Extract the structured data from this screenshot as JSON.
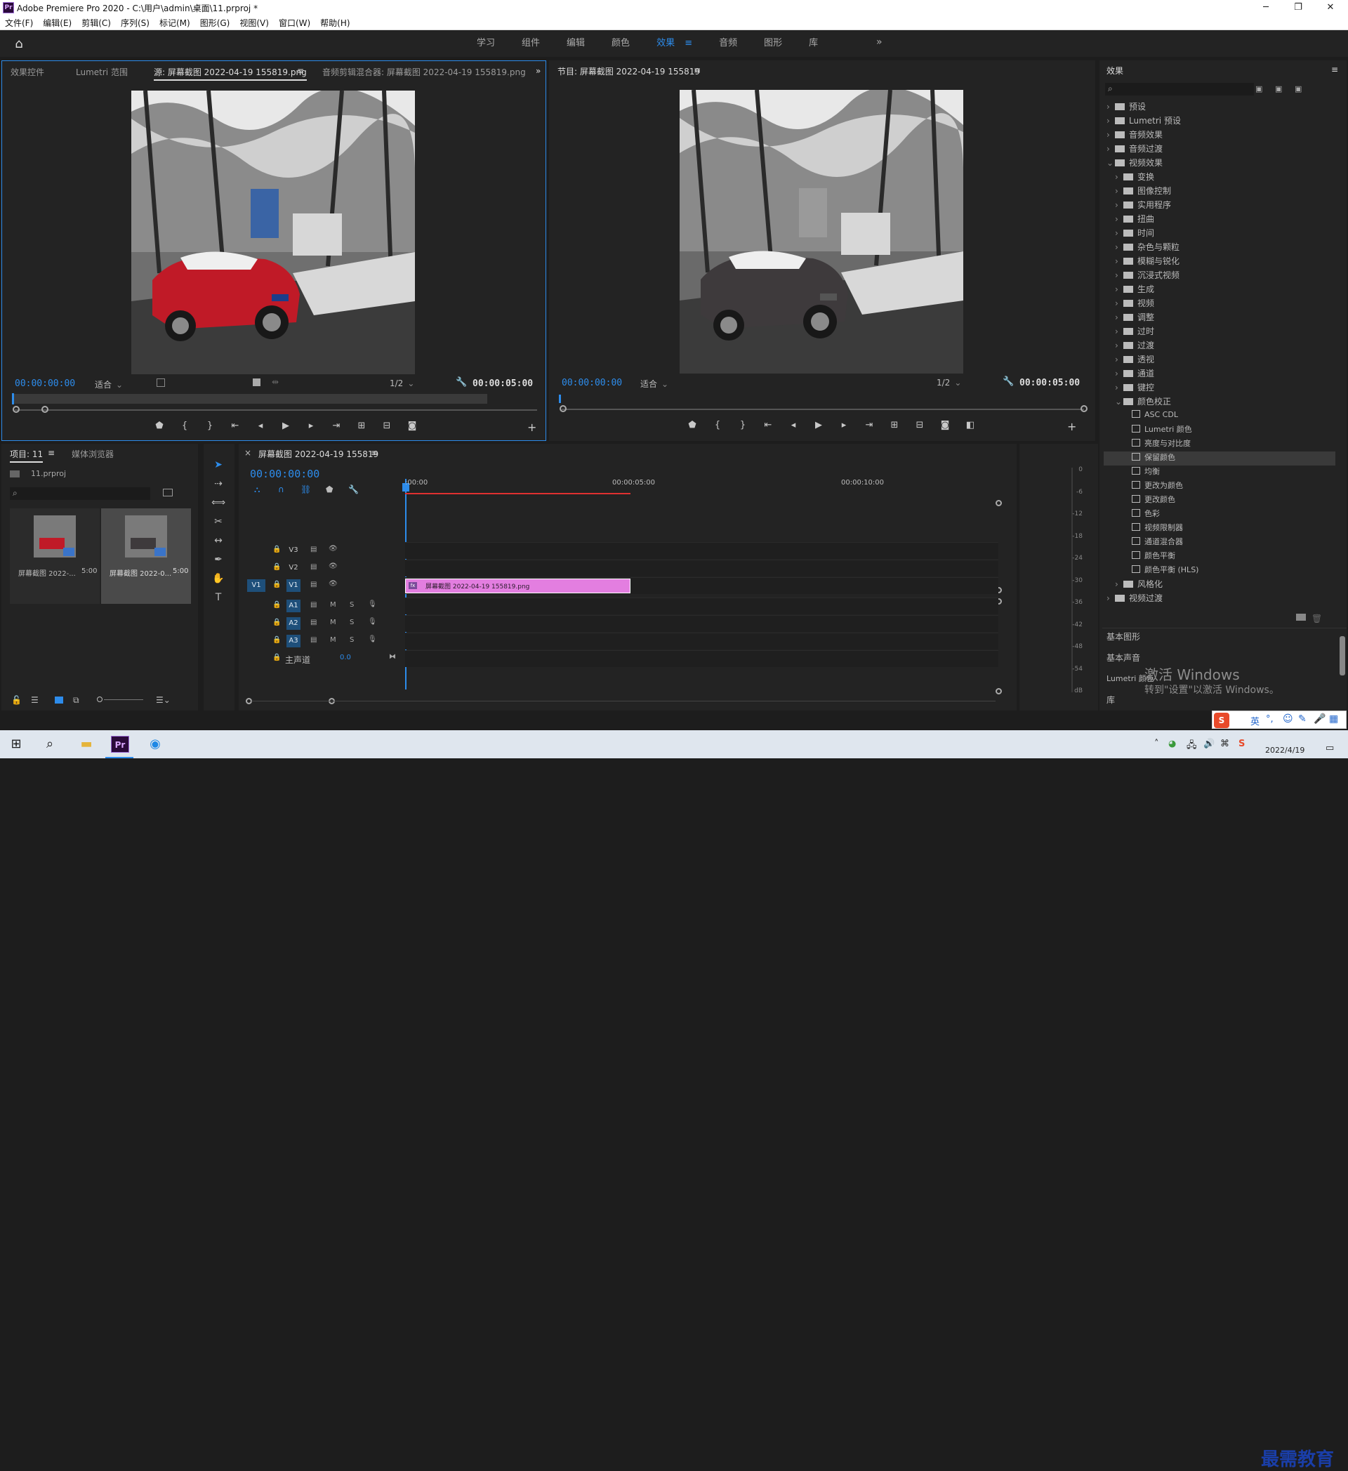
{
  "window": {
    "app_icon": "Pr",
    "title": "Adobe Premiere Pro 2020 - C:\\用户\\admin\\桌面\\11.prproj *",
    "min": "─",
    "max": "❐",
    "close": "✕"
  },
  "menu": [
    "文件(F)",
    "编辑(E)",
    "剪辑(C)",
    "序列(S)",
    "标记(M)",
    "图形(G)",
    "视图(V)",
    "窗口(W)",
    "帮助(H)"
  ],
  "workspaces": {
    "tabs": [
      "学习",
      "组件",
      "编辑",
      "颜色",
      "效果",
      "音频",
      "图形",
      "库"
    ],
    "active": "效果",
    "more": "»"
  },
  "source_panel": {
    "tabs": [
      "效果控件",
      "Lumetri 范围",
      "源: 屏幕截图 2022-04-19 155819.png",
      "音频剪辑混合器: 屏幕截图 2022-04-19 155819.png"
    ],
    "active_tab": "源: 屏幕截图 2022-04-19 155819.png",
    "timecode": "00:00:00:00",
    "fit": "适合",
    "resolution": "1/2",
    "duration": "00:00:05:00"
  },
  "program_panel": {
    "tab": "节目: 屏幕截图 2022-04-19 155819",
    "timecode": "00:00:00:00",
    "fit": "适合",
    "resolution": "1/2",
    "duration": "00:00:05:00"
  },
  "project_panel": {
    "tabs": [
      "项目: 11",
      "媒体浏览器"
    ],
    "file": "11.prproj",
    "items": [
      {
        "name": "屏幕截图 2022-...",
        "duration": "5:00"
      },
      {
        "name": "屏幕截图 2022-0...",
        "duration": "5:00"
      }
    ]
  },
  "timeline": {
    "sequence_tab": "屏幕截图 2022-04-19 155819",
    "timecode": "00:00:00:00",
    "ruler": [
      ":00:00",
      "00:00:05:00",
      "00:00:10:00"
    ],
    "video_tracks": [
      "V3",
      "V2",
      "V1"
    ],
    "audio_tracks": [
      "A1",
      "A2",
      "A3"
    ],
    "source_patch": "V1",
    "master": {
      "label": "主声道",
      "value": "0.0"
    },
    "clip": {
      "label": "屏幕截图 2022-04-19 155819.png",
      "fx": "fx",
      "color": "#e37ee0"
    },
    "mute": "M",
    "solo": "S"
  },
  "meter_scale": [
    "0",
    "-6",
    "-12",
    "-18",
    "-24",
    "-30",
    "-36",
    "-42",
    "-48",
    "-54",
    "dB"
  ],
  "effects_panel": {
    "title": "效果",
    "items": [
      {
        "label": "预设",
        "level": 0,
        "type": "folder",
        "open": false
      },
      {
        "label": "Lumetri 预设",
        "level": 0,
        "type": "folder",
        "open": false
      },
      {
        "label": "音频效果",
        "level": 0,
        "type": "folder",
        "open": false
      },
      {
        "label": "音频过渡",
        "level": 0,
        "type": "folder",
        "open": false
      },
      {
        "label": "视频效果",
        "level": 0,
        "type": "folder",
        "open": true
      },
      {
        "label": "变换",
        "level": 1,
        "type": "folder",
        "open": false
      },
      {
        "label": "图像控制",
        "level": 1,
        "type": "folder",
        "open": false
      },
      {
        "label": "实用程序",
        "level": 1,
        "type": "folder",
        "open": false
      },
      {
        "label": "扭曲",
        "level": 1,
        "type": "folder",
        "open": false
      },
      {
        "label": "时间",
        "level": 1,
        "type": "folder",
        "open": false
      },
      {
        "label": "杂色与颗粒",
        "level": 1,
        "type": "folder",
        "open": false
      },
      {
        "label": "模糊与锐化",
        "level": 1,
        "type": "folder",
        "open": false
      },
      {
        "label": "沉浸式视频",
        "level": 1,
        "type": "folder",
        "open": false
      },
      {
        "label": "生成",
        "level": 1,
        "type": "folder",
        "open": false
      },
      {
        "label": "视频",
        "level": 1,
        "type": "folder",
        "open": false
      },
      {
        "label": "调整",
        "level": 1,
        "type": "folder",
        "open": false
      },
      {
        "label": "过时",
        "level": 1,
        "type": "folder",
        "open": false
      },
      {
        "label": "过渡",
        "level": 1,
        "type": "folder",
        "open": false
      },
      {
        "label": "透视",
        "level": 1,
        "type": "folder",
        "open": false
      },
      {
        "label": "通道",
        "level": 1,
        "type": "folder",
        "open": false
      },
      {
        "label": "键控",
        "level": 1,
        "type": "folder",
        "open": false
      },
      {
        "label": "颜色校正",
        "level": 1,
        "type": "folder",
        "open": true
      },
      {
        "label": "ASC CDL",
        "level": 2,
        "type": "effect"
      },
      {
        "label": "Lumetri 颜色",
        "level": 2,
        "type": "effect"
      },
      {
        "label": "亮度与对比度",
        "level": 2,
        "type": "effect"
      },
      {
        "label": "保留颜色",
        "level": 2,
        "type": "effect",
        "selected": true
      },
      {
        "label": "均衡",
        "level": 2,
        "type": "effect"
      },
      {
        "label": "更改为颜色",
        "level": 2,
        "type": "effect"
      },
      {
        "label": "更改颜色",
        "level": 2,
        "type": "effect"
      },
      {
        "label": "色彩",
        "level": 2,
        "type": "effect"
      },
      {
        "label": "视频限制器",
        "level": 2,
        "type": "effect"
      },
      {
        "label": "通道混合器",
        "level": 2,
        "type": "effect"
      },
      {
        "label": "颜色平衡",
        "level": 2,
        "type": "effect"
      },
      {
        "label": "颜色平衡 (HLS)",
        "level": 2,
        "type": "effect"
      },
      {
        "label": "风格化",
        "level": 1,
        "type": "folder",
        "open": false
      },
      {
        "label": "视频过渡",
        "level": 0,
        "type": "folder",
        "open": false
      }
    ],
    "sections": [
      "基本图形",
      "基本声音",
      "Lumetri 颜色",
      "库"
    ]
  },
  "watermark": {
    "line1": "激活 Windows",
    "line2": "转到\"设置\"以激活 Windows。"
  },
  "ime": {
    "label": "英",
    "brand": "最需教育"
  },
  "taskbar": {
    "date": "2022/4/19"
  }
}
